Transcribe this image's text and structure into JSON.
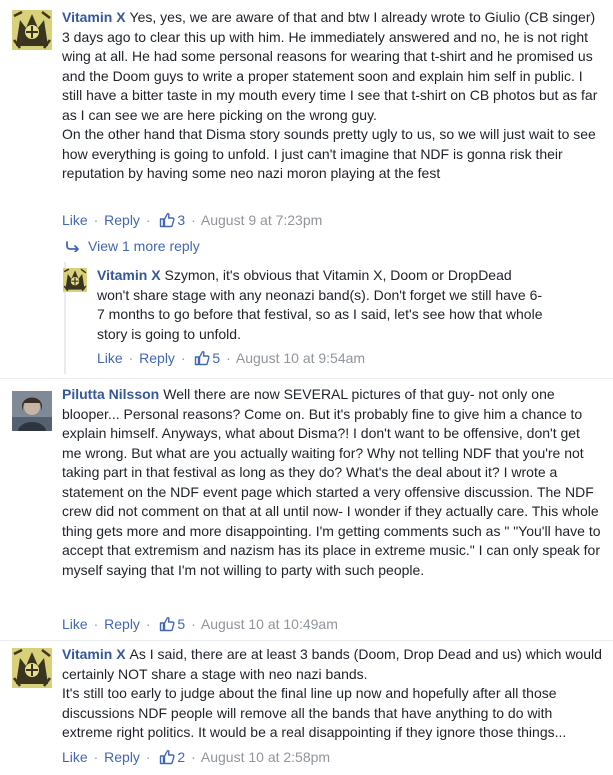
{
  "comments": [
    {
      "author": "Vitamin X",
      "text": "Yes, yes, we are aware of that and btw I already wrote to Giulio (CB singer) 3 days ago to clear this up with him. He immediately answered and no, he is not right wing at all. He had some personal reasons for wearing that t-shirt and he promised us and the Doom guys to write a proper statement soon and explain him self in public. I still have a bitter taste in my mouth every time I see that t-shirt on CB photos but as far as I can see we are here picking on the wrong guy.",
      "text2": "On the other hand that Disma story sounds pretty ugly to us, so we will just wait to see how everything is going to unfold. I just can't imagine that NDF is gonna risk their reputation by having some neo nazi moron playing at the fest",
      "like": "Like",
      "reply": "Reply",
      "likes": "3",
      "time": "August 9 at 7:23pm"
    },
    {
      "view_more": "View 1 more reply"
    },
    {
      "author": "Vitamin X",
      "text": "Szymon, it's obvious that Vitamin X, Doom or DropDead won't share stage with any neonazi band(s). Don't forget we still have 6-7 months to go before that festival, so as I said, let's see how that whole story is going to unfold.",
      "like": "Like",
      "reply": "Reply",
      "likes": "5",
      "time": "August 10 at 9:54am"
    },
    {
      "author": "Pilutta Nilsson",
      "text": "Well there are now SEVERAL pictures of that guy- not only one blooper... Personal reasons? Come on. But it's probably fine to give him a chance to explain himself. Anyways, what about Disma?! I don't want to be offensive, don't get me wrong. But what are you actually waiting for? Why not telling NDF that you're not taking part in that festival as long as they do? What's the deal about it? I wrote a statement on the NDF event page which started a very offensive discussion. The NDF crew did not comment on that at all until now- I wonder if they actually care. This whole thing gets more and more disappointing. I'm getting comments such as \" \"You'll have to accept that extremism and nazism has its place in extreme music.\" I can only speak for myself saying that I'm not willing to party with such people.",
      "like": "Like",
      "reply": "Reply",
      "likes": "5",
      "time": "August 10 at 10:49am"
    },
    {
      "author": "Vitamin X",
      "text": "As I said, there are at least 3 bands (Doom, Drop Dead and us) which would certainly NOT share a stage with neo nazi bands.",
      "text2": "It's still too early to judge about the final line up now and hopefully after all those discussions NDF people will remove all the bands that have anything to do with extreme right politics. It would be a real disappointing if they ignore those things...",
      "like": "Like",
      "reply": "Reply",
      "likes": "2",
      "time": "August 10 at 2:58pm"
    }
  ],
  "colors": {
    "author": "#365899",
    "link": "#4267b2",
    "meta": "#90949c",
    "text": "#1d2129"
  },
  "icons": [
    "thumbs-up-icon",
    "reply-arrow-icon",
    "avatar-vitamin-x",
    "avatar-pilutta"
  ]
}
